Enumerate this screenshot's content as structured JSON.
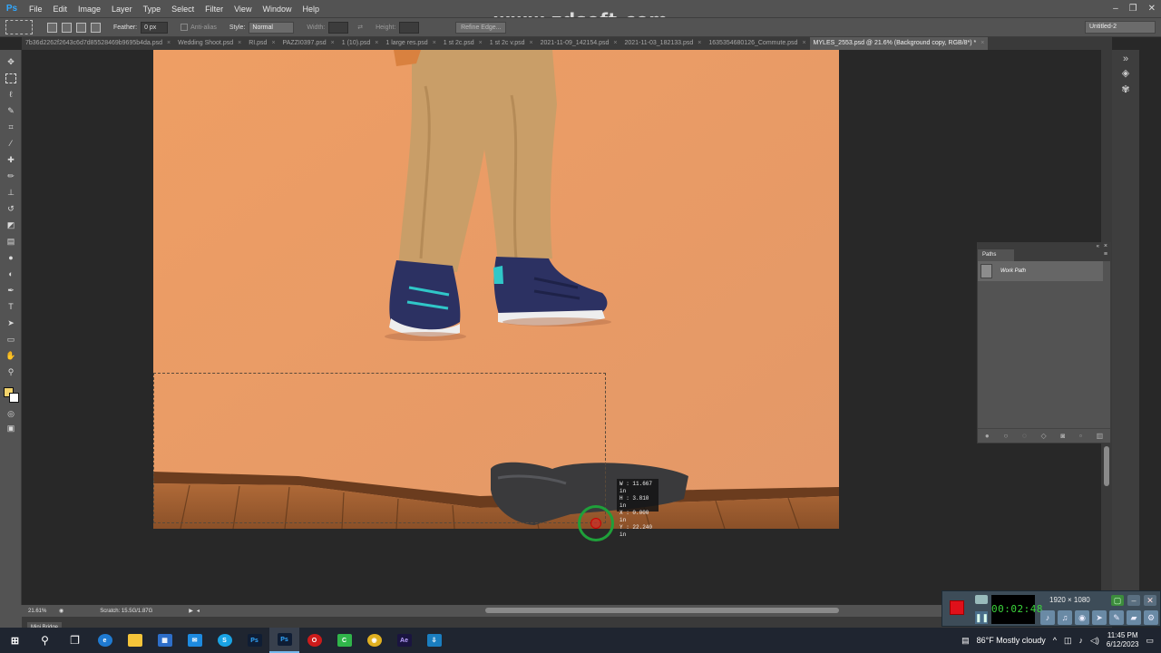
{
  "app": {
    "logo": "Ps",
    "watermark": "www.zdsoft.com"
  },
  "menu": [
    "File",
    "Edit",
    "Image",
    "Layer",
    "Type",
    "Select",
    "Filter",
    "View",
    "Window",
    "Help"
  ],
  "window_controls": {
    "minimize": "–",
    "restore": "❐",
    "close": "✕"
  },
  "options": {
    "feather_label": "Feather:",
    "feather_value": "0 px",
    "anti_alias_label": "Anti-alias",
    "style_label": "Style:",
    "style_value": "Normal",
    "width_label": "Width:",
    "height_label": "Height:",
    "refine_edge": "Refine Edge...",
    "workspace": "Untitled-2"
  },
  "tabs": [
    {
      "label": "7b36d2262f2643c6d7d85528469b9695b4da.psd",
      "close": "×"
    },
    {
      "label": "Wedding Shoot.psd",
      "close": "×"
    },
    {
      "label": "RI.psd",
      "close": "×"
    },
    {
      "label": "PAZZI0397.psd",
      "close": "×"
    },
    {
      "label": "1 (10).psd",
      "close": "×"
    },
    {
      "label": "1 large res.psd",
      "close": "×"
    },
    {
      "label": "1 st 2c.psd",
      "close": "×"
    },
    {
      "label": "1 st 2c v.psd",
      "close": "×"
    },
    {
      "label": "2021-11-09_142154.psd",
      "close": "×"
    },
    {
      "label": "2021-11-03_182133.psd",
      "close": "×"
    },
    {
      "label": "1635354680126_Commute.psd",
      "close": "×"
    },
    {
      "label": "MYLES_2553.psd @ 21.6% (Background copy, RGB/8*) *",
      "close": "×",
      "active": true
    }
  ],
  "measurement": {
    "w": "W :   11.667 in",
    "h": "H :    3.810 in",
    "x": "X :    0.000 in",
    "y": "Y :   22.240 in"
  },
  "paths_panel": {
    "tab": "Paths",
    "item": "Work Path"
  },
  "status": {
    "zoom": "21.61%",
    "scratch": "Scratch: 15.5G/1.87G",
    "arrow": "▶"
  },
  "mini_bridge": "Mini Bridge",
  "recorder": {
    "timer": "00:02:48",
    "resolution": "1920 × 1080"
  },
  "taskbar": {
    "weather": "86°F  Mostly cloudy",
    "time": "11:45 PM",
    "date": "6/12/2023"
  },
  "colors": {
    "foreground": "#f3d36b",
    "background": "#ffffff",
    "backdrop": "#e89a64",
    "accent": "#31a8ff"
  }
}
